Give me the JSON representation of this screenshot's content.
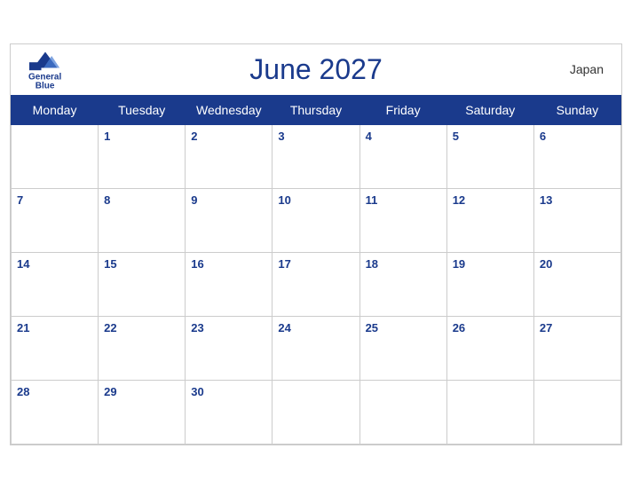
{
  "header": {
    "title": "June 2027",
    "country": "Japan",
    "logo_general": "General",
    "logo_blue": "Blue"
  },
  "days_of_week": [
    "Monday",
    "Tuesday",
    "Wednesday",
    "Thursday",
    "Friday",
    "Saturday",
    "Sunday"
  ],
  "weeks": [
    [
      null,
      1,
      2,
      3,
      4,
      5,
      6
    ],
    [
      7,
      8,
      9,
      10,
      11,
      12,
      13
    ],
    [
      14,
      15,
      16,
      17,
      18,
      19,
      20
    ],
    [
      21,
      22,
      23,
      24,
      25,
      26,
      27
    ],
    [
      28,
      29,
      30,
      null,
      null,
      null,
      null
    ]
  ]
}
